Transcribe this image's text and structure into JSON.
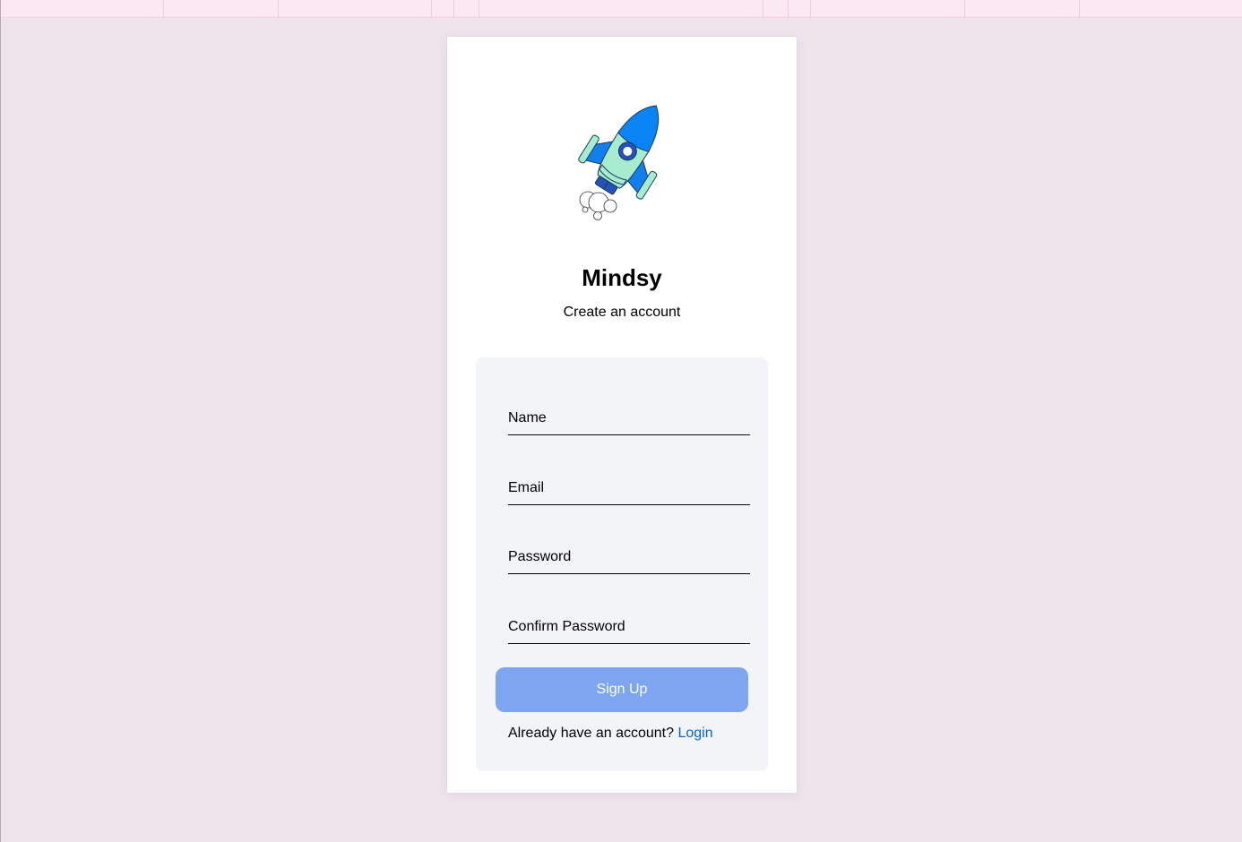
{
  "app": {
    "title": "Mindsy",
    "subtitle": "Create an account",
    "logo_icon": "rocket-icon"
  },
  "form": {
    "name_placeholder": "Name",
    "email_placeholder": "Email",
    "password_placeholder": "Password",
    "confirm_password_placeholder": "Confirm Password",
    "signup_label": "Sign Up",
    "login_prompt": "Already have an account?",
    "login_link": "Login"
  },
  "colors": {
    "background": "#f0e4ec",
    "button": "#7da5f0",
    "link": "#0b62d6",
    "rocket_body": "#a8ecd0",
    "rocket_accent": "#0a84f5"
  }
}
